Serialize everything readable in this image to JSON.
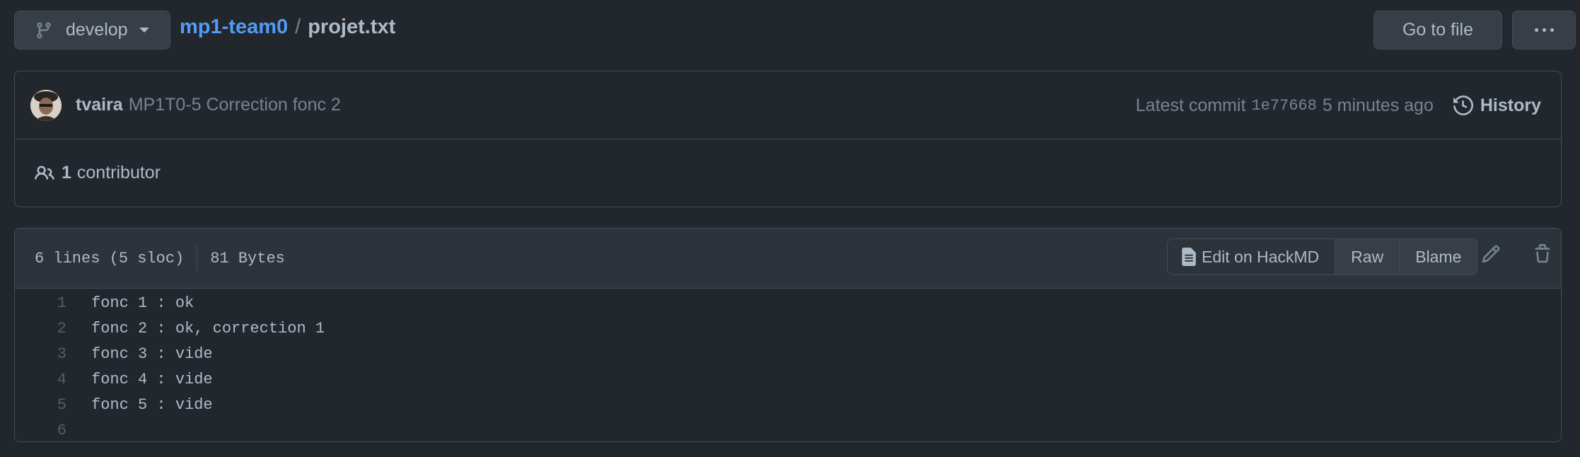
{
  "topbar": {
    "branch": "develop",
    "repo": "mp1-team0",
    "separator": "/",
    "file": "projet.txt",
    "goto_file": "Go to file"
  },
  "commit": {
    "author": "tvaira",
    "message": "MP1T0-5 Correction fonc 2",
    "latest_label": "Latest commit",
    "sha": "1e77668",
    "time": "5 minutes ago",
    "history": "History"
  },
  "contributors": {
    "count": "1",
    "label": "contributor"
  },
  "file": {
    "lines_info": "6 lines (5 sloc)",
    "size": "81 Bytes",
    "edit_hackmd": "Edit on HackMD",
    "raw": "Raw",
    "blame": "Blame",
    "lines": [
      {
        "n": "1",
        "text": "fonc 1 : ok"
      },
      {
        "n": "2",
        "text": "fonc 2 : ok, correction 1"
      },
      {
        "n": "3",
        "text": "fonc 3 : vide"
      },
      {
        "n": "4",
        "text": "fonc 4 : vide"
      },
      {
        "n": "5",
        "text": "fonc 5 : vide"
      },
      {
        "n": "6",
        "text": ""
      }
    ]
  },
  "colors": {
    "background": "#22272e",
    "accent": "#539bf5",
    "border": "#444c56"
  }
}
